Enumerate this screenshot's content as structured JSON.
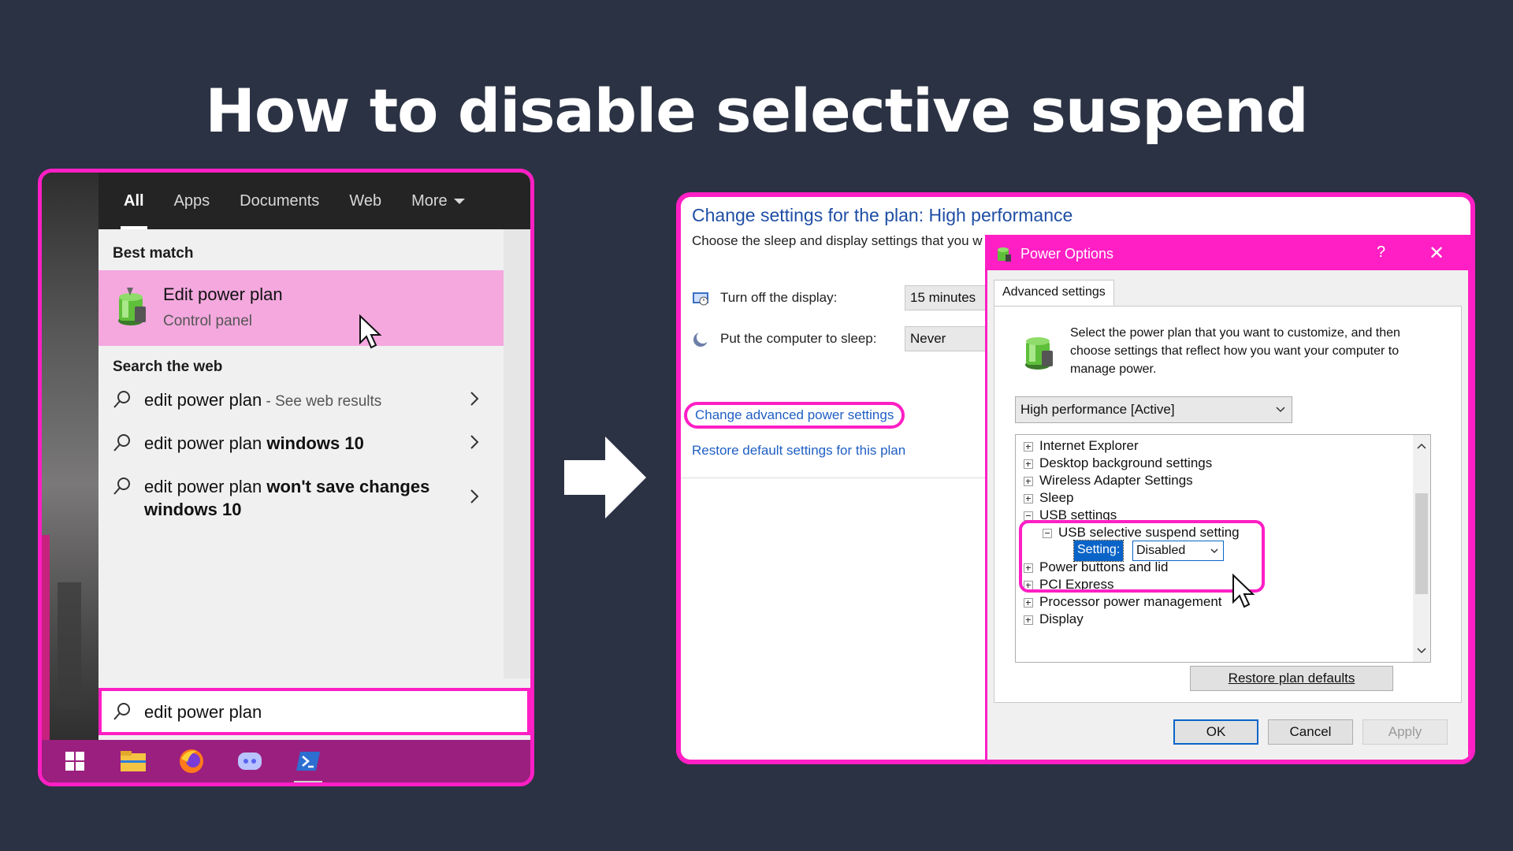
{
  "title": "How to disable selective suspend",
  "start_menu": {
    "tabs": [
      "All",
      "Apps",
      "Documents",
      "Web",
      "More"
    ],
    "best_match_heading": "Best match",
    "best_match": {
      "name": "Edit power plan",
      "sub": "Control panel"
    },
    "search_web_heading": "Search the web",
    "web_results": [
      {
        "prefix": "edit power plan",
        "bold": "",
        "suffix": " - See web results"
      },
      {
        "prefix": "edit power plan ",
        "bold": "windows 10",
        "suffix": ""
      },
      {
        "prefix": "edit power plan ",
        "bold": "won't save changes windows 10",
        "suffix": ""
      }
    ],
    "search_query": "edit power plan"
  },
  "taskbar": {
    "icons": [
      "windows-start-icon",
      "file-explorer-icon",
      "firefox-icon",
      "discord-icon",
      "powershell-icon"
    ]
  },
  "control_panel": {
    "title": "Change settings for the plan: High performance",
    "subtitle": "Choose the sleep and display settings that you w",
    "display_label": "Turn off the display:",
    "display_value": "15 minutes",
    "sleep_label": "Put the computer to sleep:",
    "sleep_value": "Never",
    "advanced_link": "Change advanced power settings",
    "restore_link": "Restore default settings for this plan"
  },
  "power_options": {
    "title": "Power Options",
    "help": "?",
    "close": "✕",
    "tab": "Advanced settings",
    "intro": "Select the power plan that you want to customize, and then choose settings that reflect how you want your computer to manage power.",
    "plan": "High performance [Active]",
    "tree": {
      "internet_explorer": "Internet Explorer",
      "desktop_background": "Desktop background settings",
      "wireless": "Wireless Adapter Settings",
      "sleep": "Sleep",
      "usb": "USB settings",
      "usb_selective": "USB selective suspend setting",
      "setting_key": "Setting:",
      "setting_value": "Disabled",
      "power_buttons": "Power buttons and lid",
      "pci": "PCI Express",
      "processor": "Processor power management",
      "display": "Display"
    },
    "restore_button": "Restore plan defaults",
    "ok": "OK",
    "cancel": "Cancel",
    "apply": "Apply"
  },
  "colors": {
    "background": "#2b3243",
    "accent": "#ff1fc4",
    "link": "#1f5fc4"
  }
}
